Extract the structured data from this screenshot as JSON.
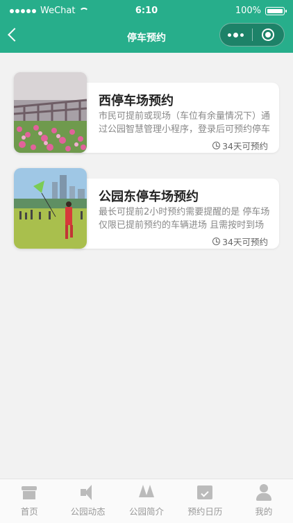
{
  "status_bar": {
    "carrier": "WeChat",
    "time": "6:10",
    "battery": "100%"
  },
  "nav": {
    "title": "停车预约"
  },
  "cards": [
    {
      "title": "西停车场预约",
      "desc": "市民可提前或现场（车位有余量情况下）通过公园智慧管理小程序，登录后可预约停车",
      "days": "34天可预约"
    },
    {
      "title": "公园东停车场预约",
      "desc": "最长可提前2小时预约需要提醒的是 停车场仅限已提前预约的车辆进场 且需按时到场",
      "days": "34天可预约"
    }
  ],
  "tabbar": {
    "items": [
      {
        "label": "首页",
        "icon": "home-icon"
      },
      {
        "label": "公园动态",
        "icon": "horn-icon"
      },
      {
        "label": "公园简介",
        "icon": "tree-icon"
      },
      {
        "label": "预约日历",
        "icon": "calendar-icon"
      },
      {
        "label": "我的",
        "icon": "user-icon"
      }
    ]
  },
  "colors": {
    "primary": "#27ae8b",
    "background": "#f2f2f2"
  }
}
